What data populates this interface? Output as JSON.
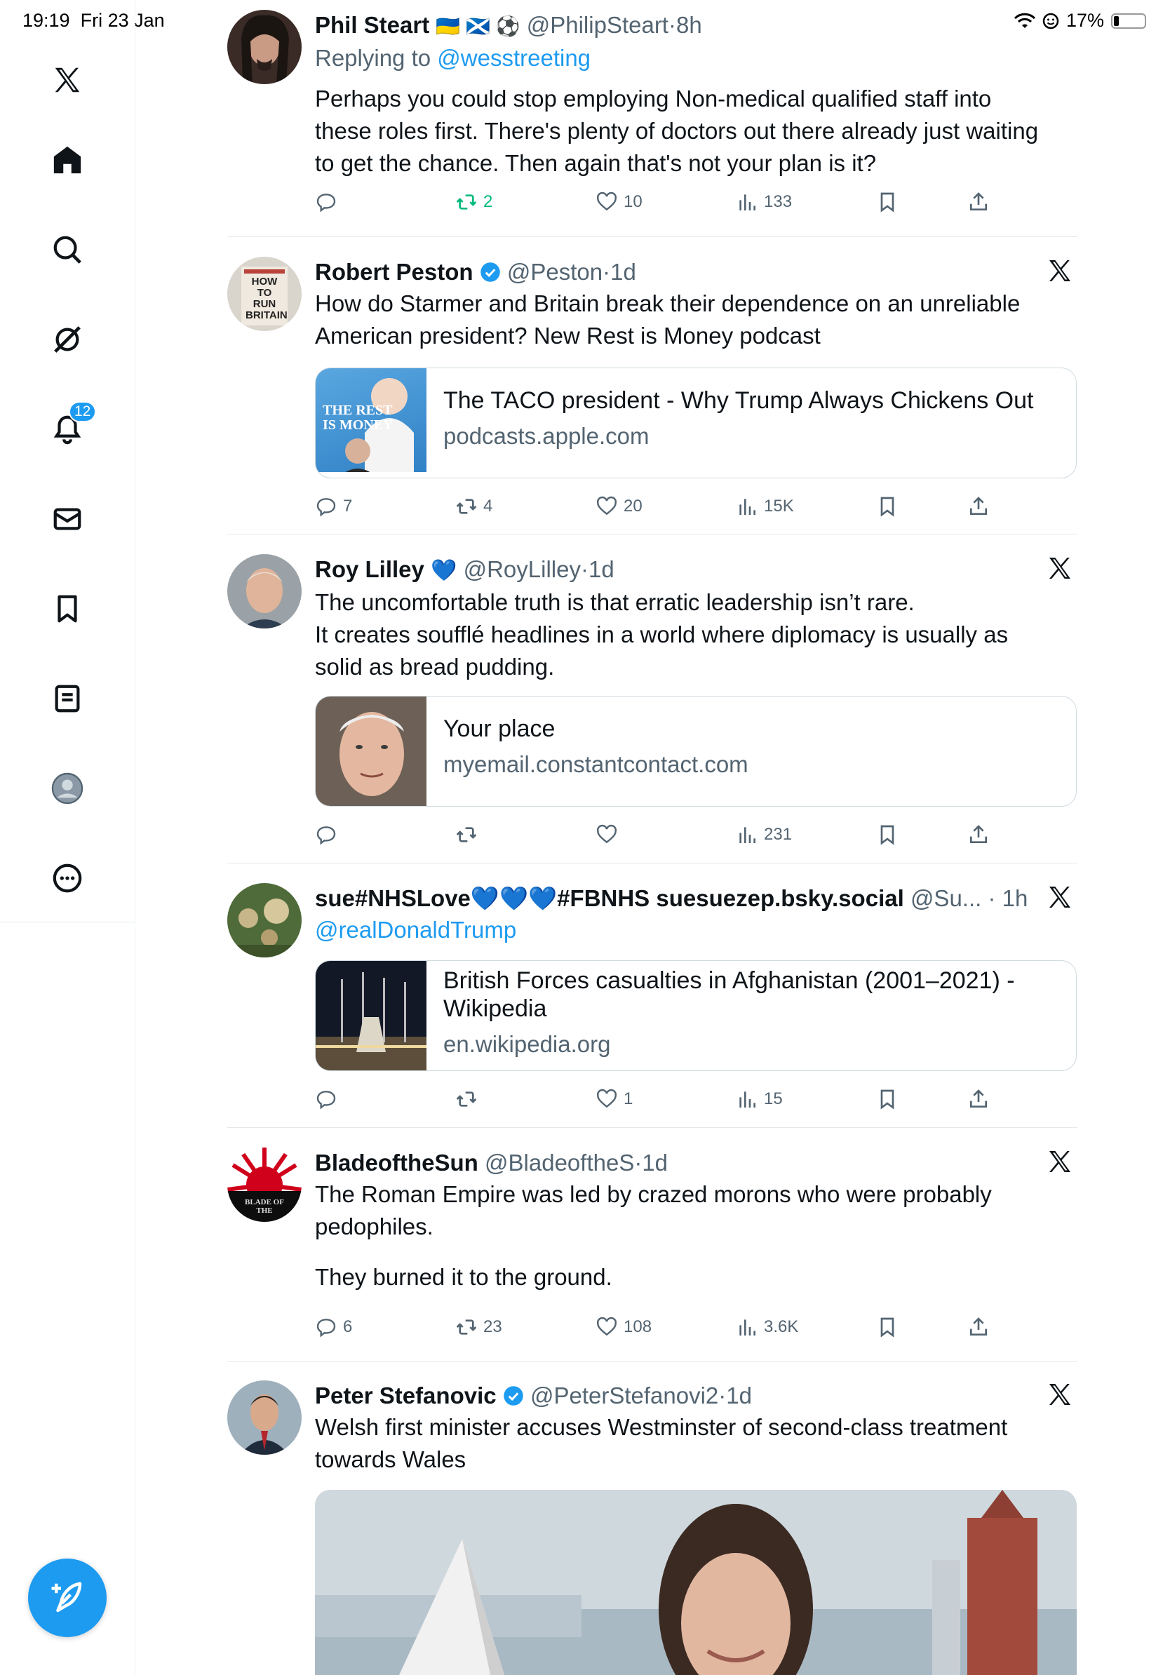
{
  "status_bar": {
    "time": "19:19",
    "date": "Fri 23 Jan",
    "battery": "17%",
    "battery_level": 0.17
  },
  "sidebar": {
    "items": [
      {
        "name": "x-logo-icon"
      },
      {
        "name": "home-icon"
      },
      {
        "name": "search-icon"
      },
      {
        "name": "grok-icon"
      },
      {
        "name": "notifications-icon",
        "badge": "12"
      },
      {
        "name": "messages-icon"
      },
      {
        "name": "bookmarks-icon"
      },
      {
        "name": "lists-icon"
      },
      {
        "name": "profile-icon"
      },
      {
        "name": "more-icon"
      }
    ],
    "compose": "compose-icon"
  },
  "tweets": [
    {
      "name": "Phil Steart",
      "flags": "🇺🇦 🏴󠁧󠁢󠁳󠁣󠁴󠁿 ⚽",
      "handle": "@PhilipSteart",
      "time": "8h",
      "reply_prefix": "Replying to",
      "reply_to": "@wesstreeting",
      "text_lines": [
        "Perhaps you could stop employing Non-medical qualified staff into",
        "these roles first. There's plenty of doctors out there already just waiting",
        "to get the chance. Then again that's not your plan is it?"
      ],
      "replies": "",
      "retweets": "2",
      "likes": "10",
      "views": "133"
    },
    {
      "name": "Robert Peston",
      "handle": "@Peston",
      "time": "1d",
      "text_lines": [
        "How do Starmer and Britain break their dependence on an unreliable",
        "American president? New Rest is Money podcast"
      ],
      "card": {
        "title": "The TACO president - Why Trump Always Chickens Out",
        "domain": "podcasts.apple.com",
        "image_text": "THE REST IS MONEY"
      },
      "replies": "7",
      "retweets": "4",
      "likes": "20",
      "views": "15K"
    },
    {
      "name": "Roy Lilley",
      "heart": "💙",
      "handle": "@RoyLilley",
      "time": "1d",
      "text_lines": [
        "The uncomfortable truth is that erratic leadership isn’t rare.",
        "It creates soufflé headlines in a world where diplomacy is usually as",
        "solid as bread pudding."
      ],
      "card": {
        "title": "Your place",
        "domain": "myemail.constantcontact.com"
      },
      "replies": "",
      "retweets": "",
      "likes": "",
      "views": "231"
    },
    {
      "name": "sue#NHSLove💙💙💙#FBNHS suesuezep.bsky.social",
      "handle": "@Su...",
      "time": "1h",
      "mention": "@realDonaldTrump",
      "card": {
        "title": "British Forces casualties in Afghanistan (2001–2021) - Wikipedia",
        "domain": "en.wikipedia.org"
      },
      "replies": "",
      "retweets": "",
      "likes": "1",
      "views": "15"
    },
    {
      "name": "BladeoftheSun",
      "handle": "@BladeoftheS",
      "time": "1d",
      "text_lines": [
        "The Roman Empire was led by crazed morons who were probably",
        "pedophiles.",
        "",
        "They burned it to the ground."
      ],
      "avatar_text": "BLADE OF THE",
      "replies": "6",
      "retweets": "23",
      "likes": "108",
      "views": "3.6K"
    },
    {
      "name": "Peter Stefanovic",
      "handle": "@PeterStefanovi2",
      "time": "1d",
      "text_lines": [
        "Welsh first minister accuses Westminster of second-class treatment",
        "towards Wales"
      ]
    }
  ],
  "peston_avatar_text": "HOW TO RUN BRITAIN",
  "colors": {
    "accent": "#1d9bf0",
    "secondary_text": "#536471",
    "retweet_green": "#00ba7c",
    "border": "#cfd9de"
  }
}
